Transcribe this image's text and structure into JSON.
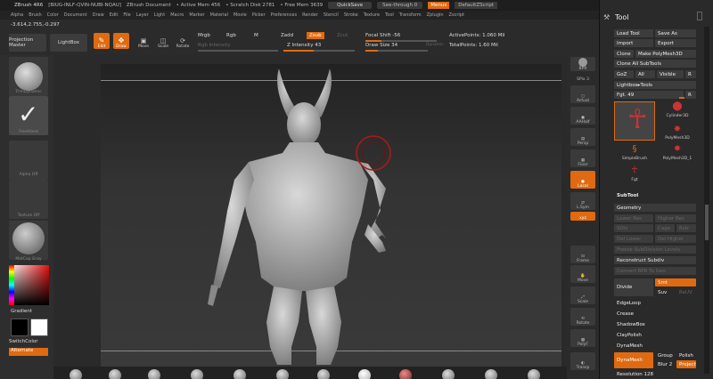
{
  "titlebar": {
    "app": "ZBrush 4R6",
    "build": "[BIUG-INLF-QVIN-NUBI-NQAU]",
    "doc": "ZBrush Document",
    "active_mem": "• Active Mem 456",
    "scratch": "• Scratch Disk 2781",
    "free_mem": "• Free Mem 3639",
    "quicksave": "QuickSave",
    "seethrough": "See-through  0",
    "menus": "Menus",
    "defaultscript": "DefaultZScript"
  },
  "menubar": [
    "Alpha",
    "Brush",
    "Color",
    "Document",
    "Draw",
    "Edit",
    "File",
    "Layer",
    "Light",
    "Macro",
    "Marker",
    "Material",
    "Movie",
    "Picker",
    "Preferences",
    "Render",
    "Stencil",
    "Stroke",
    "Texture",
    "Tool",
    "Transform",
    "Zplugin",
    "Zscript"
  ],
  "toolbar": {
    "coords": "-3.614,2.755,-0.297",
    "projection_master": "Projection Master",
    "lightbox": "LightBox",
    "edit": "Edit",
    "draw": "Draw",
    "move": "Move",
    "scale": "Scale",
    "rotate": "Rotate",
    "mrgb": "Mrgb",
    "rgb": "Rgb",
    "m": "M",
    "rgb_intensity": "Rgb Intensity",
    "zadd": "Zadd",
    "zsub": "Zsub",
    "zcut": "Zcut",
    "z_intensity": "Z Intensity 43",
    "focal_shift": "Focal Shift -56",
    "draw_size": "Draw Size 34",
    "dynamic": "Dynamic",
    "active_points": "ActivePoints: 1.060  Mil",
    "total_points": "TotalPoints: 1.60  Mil"
  },
  "leftshelf": {
    "brush": "TrimDynamic",
    "stroke": "FreeHand",
    "alpha": "Alpha Off",
    "texture": "Texture Off",
    "material": "MatCap Gray",
    "gradient": "Gradient",
    "switchcolor": "SwitchColor",
    "alternate": "Alternate"
  },
  "rightshelf": [
    "BPR",
    "SPix 3",
    "Actual",
    "AAHalf",
    "Persp",
    "Floor",
    "Local",
    "L.Sym",
    "Frame",
    "Move",
    "Scale",
    "Rotate",
    "PolyF",
    "Transp"
  ],
  "xyz": "xyz",
  "toolpanel": {
    "title": "Tool",
    "load_tool": "Load Tool",
    "save_as": "Save As",
    "import": "Import",
    "export": "Export",
    "clone": "Clone",
    "make_polymesh": "Make PolyMesh3D",
    "clone_all": "Clone All SubTools",
    "goz": "GoZ",
    "all": "All",
    "visible": "Visible",
    "r": "R",
    "lightbox_tools": "Lightbox▸Tools",
    "fgt": "Fgt. 49",
    "items": [
      "Cylinder3D",
      "PolyMesh3D",
      "SimpleBrush",
      "PolyMesh3D_1",
      "Fgt"
    ],
    "subtool": "SubTool",
    "geometry": "Geometry",
    "lower_res": "Lower Res",
    "higher_res": "Higher Res",
    "sdiv": "SDiv",
    "cage": "Cage",
    "rstr": "Rstr",
    "del_lower": "Del Lower",
    "del_higher": "Del Higher",
    "freeze": "Freeze SubDivision Levels",
    "reconstruct": "Reconstruct Subdiv",
    "convert_bpr": "Convert BPR To Geo",
    "divide": "Divide",
    "smt": "Smt",
    "suv": "Suv",
    "reuv": "ReUV",
    "edgeloop": "EdgeLoop",
    "crease": "Crease",
    "shadowbox": "ShadowBox",
    "claypolish": "ClayPolish",
    "dynamesh_section": "DynaMesh",
    "dynamesh_btn": "DynaMesh",
    "group": "Group",
    "polish": "Polish",
    "blur": "Blur 2",
    "project": "Project",
    "resolution": "Resolution 128"
  }
}
